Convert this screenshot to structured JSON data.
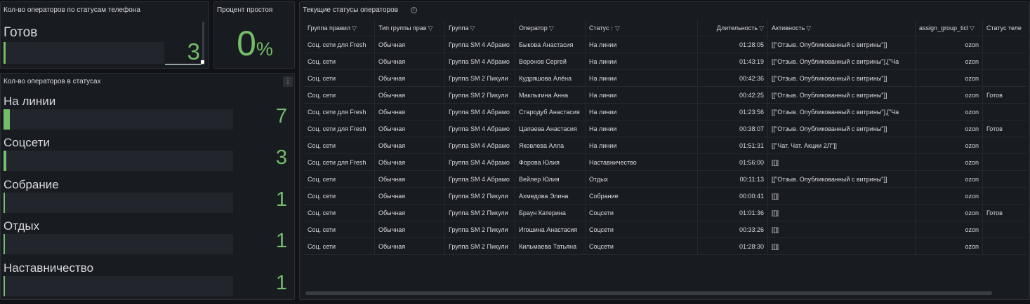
{
  "phone_panel": {
    "title": "Кол-во операторов по статусам телефона",
    "label": "Готов",
    "value": "3",
    "fill_fraction": 0.01
  },
  "idle_panel": {
    "title": "Процент простоя",
    "value": "0",
    "unit": "%"
  },
  "status_panel": {
    "title": "Кол-во операторов в статусах",
    "menu_icon": "kebab-menu-icon",
    "items": [
      {
        "label": "На линии",
        "value": "7",
        "fill_fraction": 0.027
      },
      {
        "label": "Соцсети",
        "value": "3",
        "fill_fraction": 0.012
      },
      {
        "label": "Собрание",
        "value": "1",
        "fill_fraction": 0.004
      },
      {
        "label": "Отдых",
        "value": "1",
        "fill_fraction": 0.004
      },
      {
        "label": "Наставничество",
        "value": "1",
        "fill_fraction": 0.004
      }
    ]
  },
  "table_panel": {
    "title": "Текущие статусы операторов",
    "info_icon": "info-icon",
    "filter_icon": "filter-icon",
    "sort_icon": "sort-asc-icon",
    "columns": [
      "Группа правил",
      "Тип группы прав",
      "Группа",
      "Оператор",
      "Статус",
      "Длительность",
      "Активность",
      "assign_group_ticl",
      "Статус теле"
    ],
    "rows": [
      [
        "Соц. сети для Fresh",
        "Обычная",
        "Группа SM 4 Абрамо",
        "Быкова Анастасия",
        "На линии",
        "01:28:05",
        "[[\"Отзыв. Опубликованный с витрины\"]]",
        "ozon",
        ""
      ],
      [
        "Соц. сети",
        "Обычная",
        "Группа SM 4 Абрамо",
        "Воронов Сергей",
        "На линии",
        "01:43:19",
        "[[\"Отзыв. Опубликованный с витрины\"],[\"Ча",
        "ozon",
        ""
      ],
      [
        "Соц. сети",
        "Обычная",
        "Группа SM 2 Пикули",
        "Кудряшова Алёна",
        "На линии",
        "00:42:36",
        "[[\"Отзыв. Опубликованный с витрины\"]]",
        "ozon",
        ""
      ],
      [
        "Соц. сети",
        "Обычная",
        "Группа SM 2 Пикули",
        "Маклыгина Анна",
        "На линии",
        "00:42:25",
        "[[\"Отзыв. Опубликованный с витрины\"]]",
        "ozon",
        "Готов"
      ],
      [
        "Соц. сети для Fresh",
        "Обычная",
        "Группа SM 4 Абрамо",
        "Стародуб Анастасия",
        "На линии",
        "01:23:56",
        "[[\"Отзыв. Опубликованный с витрины\"],[\"Ча",
        "ozon",
        ""
      ],
      [
        "Соц. сети для Fresh",
        "Обычная",
        "Группа SM 4 Абрамо",
        "Цапаева Анастасия",
        "На линии",
        "00:38:07",
        "[[\"Отзыв. Опубликованный с витрины\"]]",
        "ozon",
        "Готов"
      ],
      [
        "Соц. сети",
        "Обычная",
        "Группа SM 4 Абрамо",
        "Яковлева Алла",
        "На линии",
        "01:51:31",
        "[[\"Чат. Чат. Акции 2Л\"]]",
        "ozon",
        ""
      ],
      [
        "Соц. сети для Fresh",
        "Обычная",
        "Группа SM 4 Абрамо",
        "Форова Юлия",
        "Наставничество",
        "01:56:00",
        "[[]]",
        "ozon",
        ""
      ],
      [
        "Соц. сети",
        "Обычная",
        "Группа SM 4 Абрамо",
        "Вейлер Юлия",
        "Отдых",
        "00:11:13",
        "[[\"Отзыв. Опубликованный с витрины\"]]",
        "ozon",
        ""
      ],
      [
        "Соц. сети",
        "Обычная",
        "Группа SM 2 Пикули",
        "Ахмедова Элина",
        "Собрание",
        "00:00:41",
        "[[]]",
        "ozon",
        ""
      ],
      [
        "Соц. сети",
        "Обычная",
        "Группа SM 2 Пикули",
        "Браун Катерина",
        "Соцсети",
        "01:01:36",
        "[[]]",
        "ozon",
        "Готов"
      ],
      [
        "Соц. сети",
        "Обычная",
        "Группа SM 2 Пикули",
        "Игошина Анастасия",
        "Соцсети",
        "00:33:26",
        "[[]]",
        "ozon",
        ""
      ],
      [
        "Соц. сети",
        "Обычная",
        "Группа SM 2 Пикули",
        "Кильмаева Татьяна",
        "Соцсети",
        "01:28:30",
        "[[]]",
        "ozon",
        ""
      ]
    ]
  },
  "colors": {
    "background": "#111217",
    "panel": "#181b1f",
    "accent_green": "#73bf69",
    "text": "#d8d9e0"
  }
}
